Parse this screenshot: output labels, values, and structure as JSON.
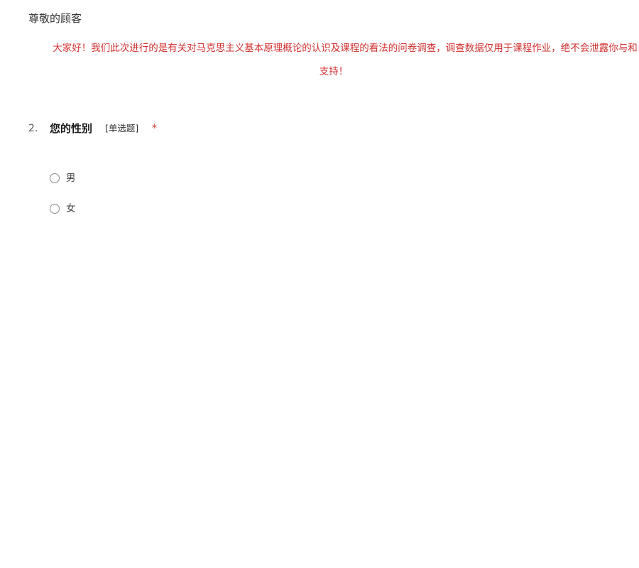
{
  "survey": {
    "greeting": "尊敬的顾客",
    "intro": "大家好！我们此次进行的是有关对马克思主义基本原理概论的认识及课程的看法的问卷调查，调查数据仅用于课程作业，绝不会泄露你与和支持！"
  },
  "question": {
    "number": "2.",
    "title": "您的性别",
    "type_label": "[单选题]",
    "required_mark": "*",
    "options": [
      {
        "label": "男"
      },
      {
        "label": "女"
      }
    ]
  },
  "colors": {
    "intro_text": "#d03030",
    "required_mark": "#e04040",
    "body_text": "#333333"
  }
}
